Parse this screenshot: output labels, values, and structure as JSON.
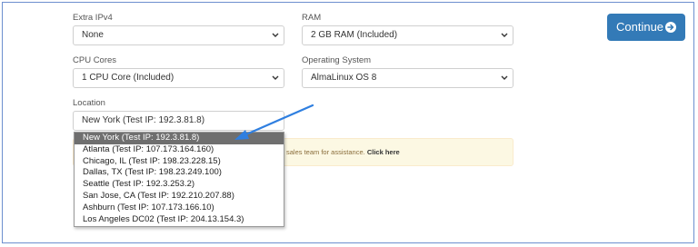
{
  "form": {
    "extra_ipv4": {
      "label": "Extra IPv4",
      "value": "None"
    },
    "ram": {
      "label": "RAM",
      "value": "2 GB RAM (Included)"
    },
    "cpu": {
      "label": "CPU Cores",
      "value": "1 CPU Core (Included)"
    },
    "os": {
      "label": "Operating System",
      "value": "AlmaLinux OS 8"
    },
    "location": {
      "label": "Location",
      "value": "New York (Test IP: 192.3.81.8)",
      "options": [
        "New York (Test IP: 192.3.81.8)",
        "Atlanta (Test IP: 107.173.164.160)",
        "Chicago, IL (Test IP: 198.23.228.15)",
        "Dallas, TX (Test IP: 198.23.249.100)",
        "Seattle (Test IP: 192.3.253.2)",
        "San Jose, CA (Test IP: 192.210.207.88)",
        "Ashburn (Test IP: 107.173.166.10)",
        "Los Angeles DC02 (Test IP: 204.13.154.3)"
      ],
      "selected_index": 0
    }
  },
  "alert": {
    "text": "sales team for assistance.",
    "link": "Click here"
  },
  "continue_button": {
    "label": "Continue",
    "icon": "arrow-circle-right-icon"
  },
  "colors": {
    "primary": "#337ab7",
    "alert_bg": "#fcf8e3",
    "selected_option": "#6f6f6f",
    "annotation_arrow": "#2f7fe0"
  }
}
